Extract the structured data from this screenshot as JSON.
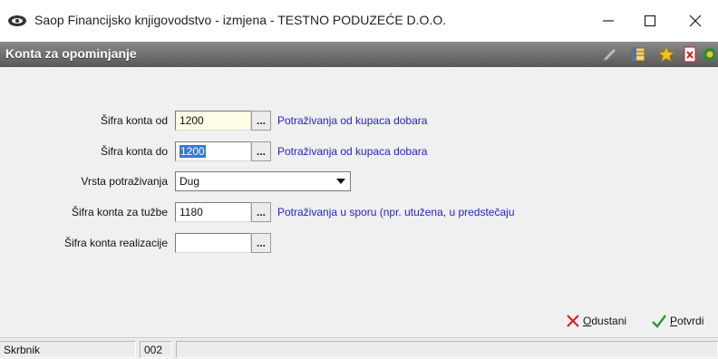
{
  "window": {
    "title": "Saop Financijsko knjigovodstvo - izmjena  - TESTNO PODUZEĆE D.O.O."
  },
  "header": {
    "title": "Konta za opominjanje"
  },
  "form": {
    "konto_od": {
      "label": "Šifra konta od",
      "value": "1200",
      "description": "Potraživanja od kupaca dobara"
    },
    "konto_do": {
      "label": "Šifra konta do",
      "value": "1200",
      "description": "Potraživanja od kupaca dobara"
    },
    "vrsta": {
      "label": "Vrsta potraživanja",
      "value": "Dug"
    },
    "konto_tuzbe": {
      "label": "Šifra konta za tužbe",
      "value": "1180",
      "description": "Potraživanja u sporu (npr. utužena, u predstečaju"
    },
    "konto_realizacije": {
      "label": "Šifra konta realizacije",
      "value": ""
    },
    "browse_label": "..."
  },
  "actions": {
    "cancel_first": "O",
    "cancel_rest": "dustani",
    "confirm_first": "P",
    "confirm_rest": "otvrdi"
  },
  "status": {
    "user": "Skrbnik",
    "code": "002",
    "message": ""
  },
  "colors": {
    "description_text": "#2424c8",
    "header_bar": "#6e6e6e",
    "selection": "#3a78d4",
    "cancel_icon": "#d42020",
    "confirm_icon": "#2a9a2a"
  }
}
